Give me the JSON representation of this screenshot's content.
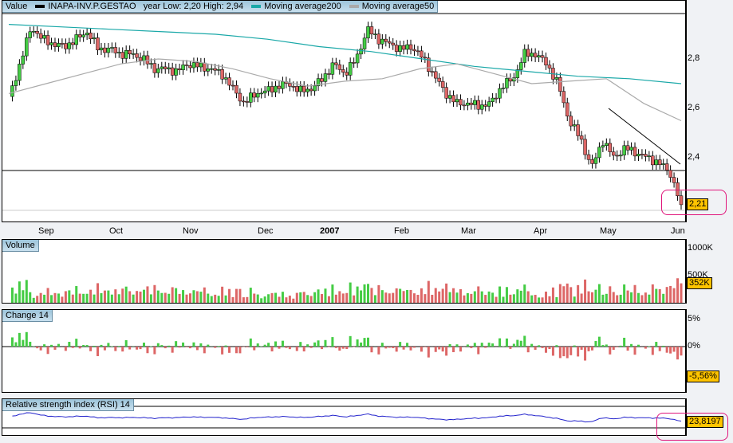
{
  "main": {
    "title": "Value",
    "symbol": "INAPA-INV.P.GESTAO",
    "range": "year Low: 2,20 High: 2,94",
    "ma200": "Moving average200",
    "ma50": "Moving average50",
    "last": "2,21",
    "yticks": [
      "2,8",
      "2,6",
      "2,4"
    ],
    "months": [
      "Sep",
      "Oct",
      "Nov",
      "Dec",
      "2007",
      "Feb",
      "Mar",
      "Apr",
      "May",
      "Jun"
    ]
  },
  "volume": {
    "title": "Volume",
    "ticks": [
      "1000K",
      "500K"
    ],
    "last": "352K"
  },
  "change": {
    "title": "Change 14",
    "ticks": [
      "5%",
      "0%"
    ],
    "last": "-5,56%"
  },
  "rsi": {
    "title": "Relative strength index (RSI) 14",
    "last": "23,8197"
  },
  "colors": {
    "up": "#44cc44",
    "down": "#dd6666",
    "ma200": "#1aa8a8",
    "ma50": "#aaaaaa",
    "rsi": "#2222cc",
    "badge": "#ffc400"
  },
  "chart_data": {
    "type": "candlestick",
    "ylim": [
      2.15,
      3.0
    ],
    "close": [
      2.64,
      2.78,
      2.93,
      2.88,
      2.86,
      2.85,
      2.88,
      2.91,
      2.84,
      2.84,
      2.82,
      2.82,
      2.8,
      2.76,
      2.76,
      2.75,
      2.78,
      2.77,
      2.76,
      2.74,
      2.68,
      2.62,
      2.66,
      2.67,
      2.69,
      2.7,
      2.67,
      2.68,
      2.72,
      2.78,
      2.74,
      2.8,
      2.92,
      2.88,
      2.86,
      2.84,
      2.85,
      2.8,
      2.73,
      2.66,
      2.62,
      2.62,
      2.61,
      2.62,
      2.69,
      2.72,
      2.82,
      2.82,
      2.78,
      2.7,
      2.55,
      2.48,
      2.36,
      2.47,
      2.4,
      2.44,
      2.42,
      2.4,
      2.38,
      2.34,
      2.21
    ],
    "ma200": [
      2.94,
      2.93,
      2.92,
      2.91,
      2.9,
      2.88,
      2.85,
      2.83,
      2.8,
      2.77,
      2.75,
      2.73,
      2.72,
      2.7
    ],
    "ma50": [
      2.66,
      2.7,
      2.74,
      2.78,
      2.8,
      2.79,
      2.76,
      2.72,
      2.69,
      2.71,
      2.72,
      2.76,
      2.78,
      2.74,
      2.7,
      2.71,
      2.72,
      2.62,
      2.55
    ]
  }
}
